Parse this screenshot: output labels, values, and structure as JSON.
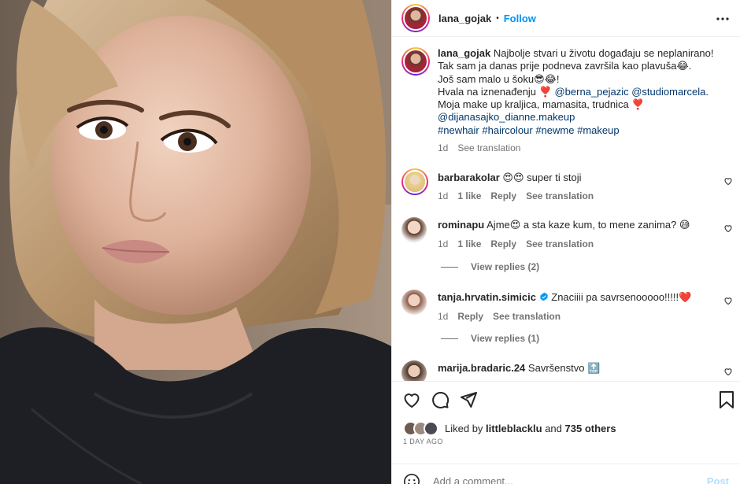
{
  "header": {
    "username": "lana_gojak",
    "separator": "•",
    "follow_label": "Follow",
    "more_icon": "more-options-icon"
  },
  "caption": {
    "username": "lana_gojak",
    "lines": [
      "Najbolje stvari u životu događaju se neplanirano!",
      "Tak sam ja danas prije podneva završila kao plavuša😂.",
      "Još sam malo u šoku😎😂!"
    ],
    "thanks_prefix": "Hvala na iznenađenju ❣️ ",
    "mention_1": "@berna_pejazic",
    "mention_2": "@studiomarcela",
    "thanks_suffix": ".",
    "line_makeup": "Moja make up kraljica, mamasita, trudnica ❣️",
    "mention_3": "@dijanasajko_dianne.makeup",
    "hashtags": [
      "#newhair",
      "#haircolour",
      "#newme",
      "#makeup"
    ],
    "time": "1d",
    "see_translation": "See translation"
  },
  "comments": [
    {
      "username": "barbarakolar",
      "text": "😍😍 super ti stoji",
      "time": "1d",
      "likes": "1 like",
      "reply": "Reply",
      "see_translation": "See translation"
    },
    {
      "username": "rominapu",
      "text": "Ajme😍 a sta kaze kum, to mene zanima? 😅",
      "time": "1d",
      "likes": "1 like",
      "reply": "Reply",
      "see_translation": "See translation",
      "view_replies": "View replies (2)"
    },
    {
      "username": "tanja.hrvatin.simicic",
      "verified": true,
      "text": "Znaciiii pa savrsenooooo!!!!!❤️",
      "time": "1d",
      "reply": "Reply",
      "see_translation": "See translation",
      "view_replies": "View replies (1)"
    },
    {
      "username": "marija.bradaric.24",
      "text": "Savršenstvo 🔝"
    }
  ],
  "actions": {
    "liked_by_prefix": "Liked by",
    "liked_by_user": "littleblacklu",
    "and": "and",
    "others": "735 others",
    "time_ago": "1 DAY AGO"
  },
  "add_comment": {
    "placeholder": "Add a comment...",
    "post_label": "Post"
  },
  "colors": {
    "link": "#00376b",
    "follow": "#0095f6",
    "muted": "#737373",
    "post_disabled": "#b2dffc",
    "heart_red": "#ed4956"
  }
}
